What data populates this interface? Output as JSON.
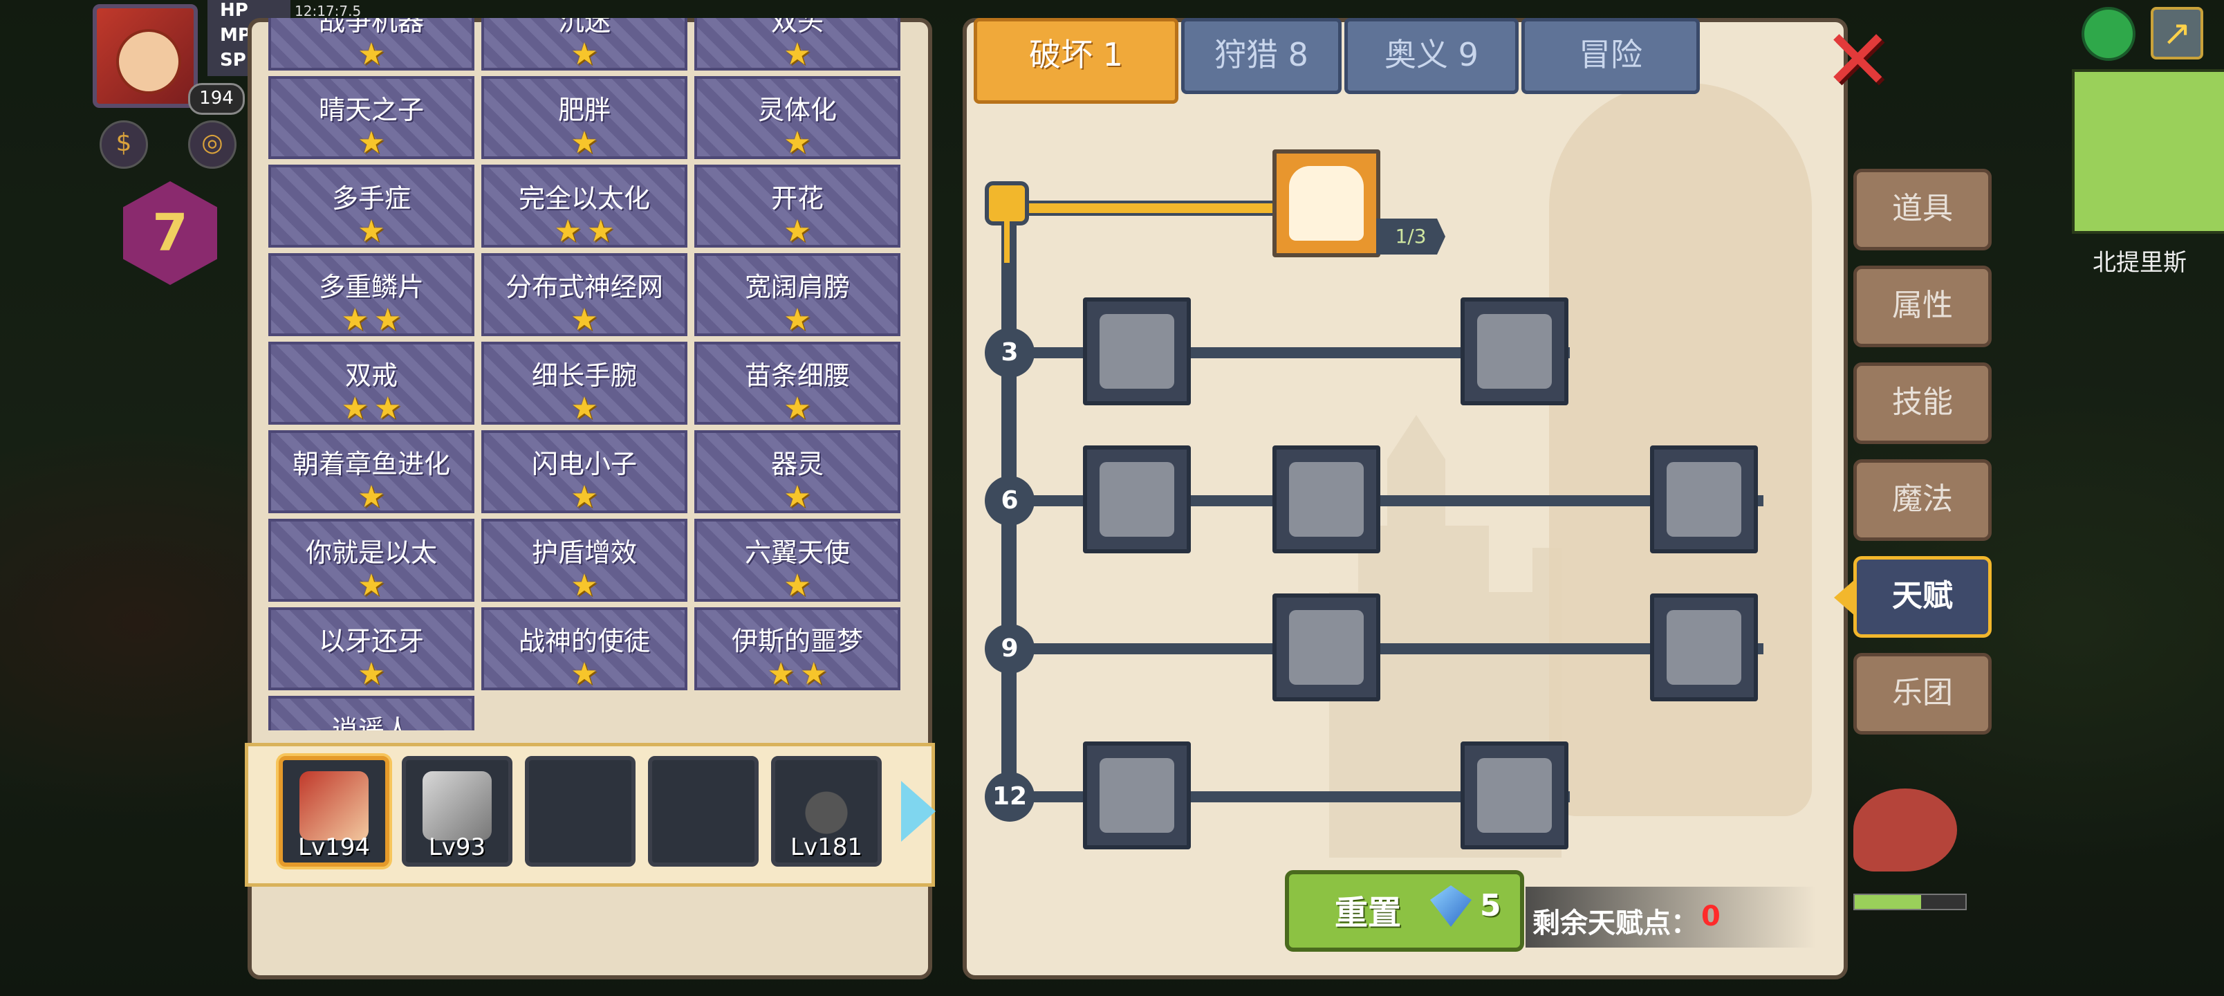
{
  "hud": {
    "avatar_level": "194",
    "bar_labels": [
      "HP",
      "MP",
      "SP"
    ],
    "time": "12:17:7.5",
    "player_level": "7"
  },
  "talents": [
    {
      "name": "战争机器",
      "stars": 1
    },
    {
      "name": "沉迷",
      "stars": 1
    },
    {
      "name": "双头",
      "stars": 1
    },
    {
      "name": "晴天之子",
      "stars": 1
    },
    {
      "name": "肥胖",
      "stars": 1
    },
    {
      "name": "灵体化",
      "stars": 1
    },
    {
      "name": "多手症",
      "stars": 1
    },
    {
      "name": "完全以太化",
      "stars": 2
    },
    {
      "name": "开花",
      "stars": 1
    },
    {
      "name": "多重鳞片",
      "stars": 2
    },
    {
      "name": "分布式神经网",
      "stars": 1
    },
    {
      "name": "宽阔肩膀",
      "stars": 1
    },
    {
      "name": "双戒",
      "stars": 2
    },
    {
      "name": "细长手腕",
      "stars": 1
    },
    {
      "name": "苗条细腰",
      "stars": 1
    },
    {
      "name": "朝着章鱼进化",
      "stars": 1
    },
    {
      "name": "闪电小子",
      "stars": 1
    },
    {
      "name": "器灵",
      "stars": 1
    },
    {
      "name": "你就是以太",
      "stars": 1
    },
    {
      "name": "护盾增效",
      "stars": 1
    },
    {
      "name": "六翼天使",
      "stars": 1
    },
    {
      "name": "以牙还牙",
      "stars": 1
    },
    {
      "name": "战神的使徒",
      "stars": 1
    },
    {
      "name": "伊斯的噩梦",
      "stars": 2
    },
    {
      "name": "逍遥人",
      "stars": 0
    }
  ],
  "team": [
    {
      "level": "Lv194",
      "selected": true
    },
    {
      "level": "Lv93",
      "selected": false
    },
    {
      "level": "",
      "selected": false
    },
    {
      "level": "",
      "selected": false
    },
    {
      "level": "Lv181",
      "selected": false
    }
  ],
  "tree_tabs": [
    {
      "label": "破坏 1",
      "active": true
    },
    {
      "label": "狩猎 8",
      "active": false
    },
    {
      "label": "奥义 9",
      "active": false
    },
    {
      "label": "冒险",
      "active": false
    }
  ],
  "tree": {
    "top_node_level": "1/3",
    "row_labels": [
      "3",
      "6",
      "9",
      "12"
    ],
    "reset_label": "重置",
    "reset_cost": "5",
    "points_label": "剩余天赋点：",
    "points_value": "0"
  },
  "side_menu": [
    {
      "label": "道具",
      "active": false
    },
    {
      "label": "属性",
      "active": false
    },
    {
      "label": "技能",
      "active": false
    },
    {
      "label": "魔法",
      "active": false
    },
    {
      "label": "天赋",
      "active": true
    },
    {
      "label": "乐团",
      "active": false
    }
  ],
  "map": {
    "location": "北提里斯"
  },
  "icons": [
    "close-icon",
    "globe-icon",
    "exit-icon",
    "diamond-icon",
    "arm-wrestle-icon"
  ],
  "colors": {
    "accent": "#f2b72c",
    "cell": "#6a6597",
    "close": "#e23a3a",
    "points_value": "#ff2a2a"
  }
}
